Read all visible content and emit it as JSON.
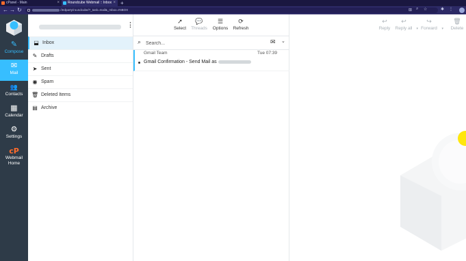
{
  "browser": {
    "tabs": [
      {
        "label": "cPanel - Main"
      },
      {
        "label": "Roundcube Webmail :: Inbox"
      }
    ],
    "new_tab": "+",
    "close": "×",
    "back": "←",
    "forward": "→",
    "reload": "↻",
    "url_visible": "/3rdparty/roundcube/?_task=mail&_mbox=INBOX",
    "icons": [
      "translate-icon",
      "search-icon",
      "star-icon",
      "extensions-icon",
      "menu-icon"
    ]
  },
  "sidebar": {
    "items": [
      {
        "label": "Compose",
        "icon": "✎"
      },
      {
        "label": "Mail",
        "icon": "✉"
      },
      {
        "label": "Contacts",
        "icon": "👥"
      },
      {
        "label": "Calendar",
        "icon": "▦"
      },
      {
        "label": "Settings",
        "icon": "⚙"
      },
      {
        "label": "Webmail Home",
        "icon": "cP"
      }
    ]
  },
  "folders": {
    "menu_icon": "⋮",
    "items": [
      {
        "label": "Inbox",
        "icon": "⬓"
      },
      {
        "label": "Drafts",
        "icon": "✎"
      },
      {
        "label": "Sent",
        "icon": "➤"
      },
      {
        "label": "Spam",
        "icon": "◉"
      },
      {
        "label": "Deleted Items",
        "icon": "🗑"
      },
      {
        "label": "Archive",
        "icon": "▤"
      }
    ]
  },
  "list_toolbar": {
    "select": {
      "label": "Select",
      "icon": "➚"
    },
    "threads": {
      "label": "Threads",
      "icon": "💬"
    },
    "options": {
      "label": "Options",
      "icon": "☰"
    },
    "refresh": {
      "label": "Refresh",
      "icon": "⟳"
    }
  },
  "search": {
    "placeholder": "Search...",
    "icon": "⌕",
    "envelope": "✉",
    "chevron": "⌄"
  },
  "messages": [
    {
      "from": "Gmail Team",
      "date": "Tue 07:39",
      "subject": "Gmail Confirmation - Send Mail as"
    }
  ],
  "read_toolbar": {
    "reply": {
      "label": "Reply",
      "icon": "↩"
    },
    "reply_all": {
      "label": "Reply all",
      "icon": "↩"
    },
    "forward": {
      "label": "Forward",
      "icon": "↪"
    },
    "delete": {
      "label": "Delete",
      "icon": "🗑"
    },
    "dropdown": "▾"
  },
  "colors": {
    "accent": "#37beff",
    "nav_bg": "#2e3b48",
    "cpanel_orange": "#ff6c2c"
  }
}
